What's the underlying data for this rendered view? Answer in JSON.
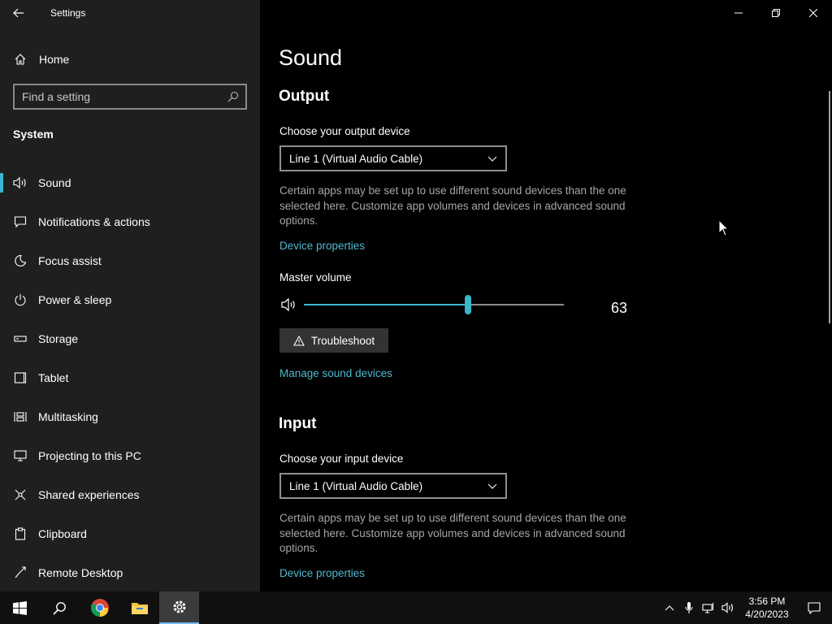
{
  "app": {
    "title": "Settings"
  },
  "sidebar": {
    "home_label": "Home",
    "search_placeholder": "Find a setting",
    "section_title": "System",
    "items": [
      {
        "label": "Sound",
        "icon": "speaker-icon",
        "active": true
      },
      {
        "label": "Notifications & actions",
        "icon": "notification-icon"
      },
      {
        "label": "Focus assist",
        "icon": "moon-icon"
      },
      {
        "label": "Power & sleep",
        "icon": "power-icon"
      },
      {
        "label": "Storage",
        "icon": "storage-icon"
      },
      {
        "label": "Tablet",
        "icon": "tablet-icon"
      },
      {
        "label": "Multitasking",
        "icon": "multitasking-icon"
      },
      {
        "label": "Projecting to this PC",
        "icon": "projecting-icon"
      },
      {
        "label": "Shared experiences",
        "icon": "shared-experiences-icon"
      },
      {
        "label": "Clipboard",
        "icon": "clipboard-icon"
      },
      {
        "label": "Remote Desktop",
        "icon": "remote-desktop-icon"
      }
    ]
  },
  "main": {
    "page_title": "Sound",
    "output": {
      "heading": "Output",
      "device_label": "Choose your output device",
      "device_value": "Line 1 (Virtual Audio Cable)",
      "description": "Certain apps may be set up to use different sound devices than the one selected here. Customize app volumes and devices in advanced sound options.",
      "device_properties_link": "Device properties",
      "master_volume_label": "Master volume",
      "volume_value": "63",
      "volume_level": 63,
      "troubleshoot_label": "Troubleshoot",
      "manage_devices_link": "Manage sound devices"
    },
    "input": {
      "heading": "Input",
      "device_label": "Choose your input device",
      "device_value": "Line 1 (Virtual Audio Cable)",
      "description": "Certain apps may be set up to use different sound devices than the one selected here. Customize app volumes and devices in advanced sound options.",
      "device_properties_link": "Device properties"
    }
  },
  "taskbar": {
    "time": "3:56 PM",
    "date": "4/20/2023"
  },
  "colors": {
    "accent": "#3ab7cc",
    "link": "#4fb8cf",
    "sidebar_bg": "#1f1f1f",
    "main_bg": "#000000"
  }
}
